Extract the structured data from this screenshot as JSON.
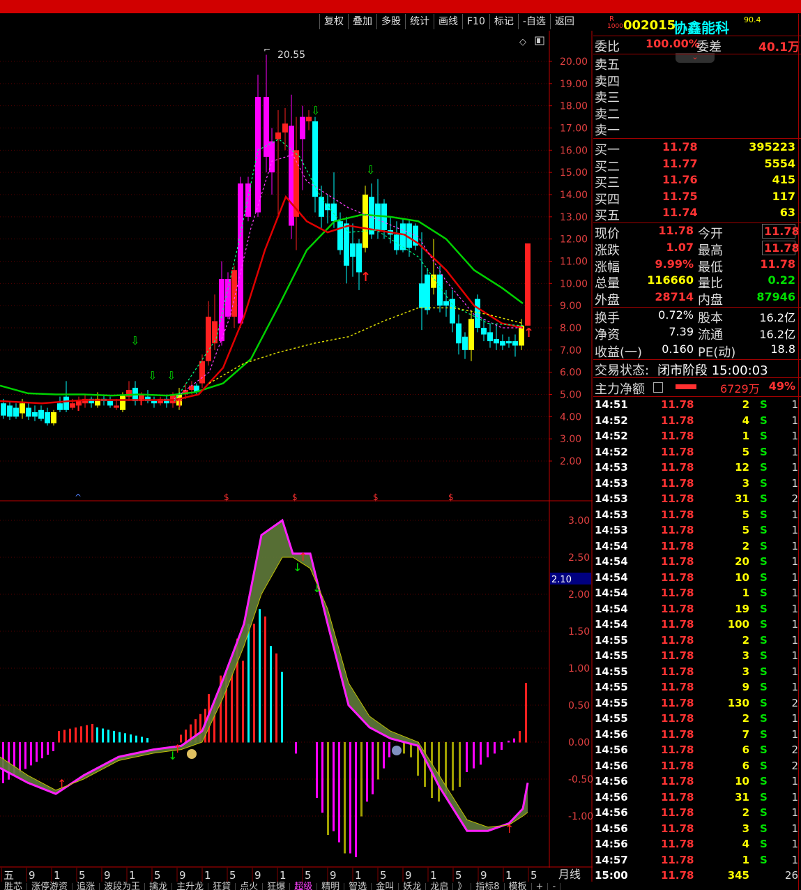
{
  "toolbar": [
    "复权",
    "叠加",
    "多股",
    "统计",
    "画线",
    "F10",
    "标记",
    "-自选",
    "返回"
  ],
  "stock": {
    "badge_top": "R",
    "badge_bottom": "1000",
    "code": "002015",
    "name": "协鑫能科",
    "score": "90.4"
  },
  "weibi": {
    "label": "委比",
    "value": "100.00%",
    "diff_label": "委差",
    "diff_value": "40.1万"
  },
  "sells": [
    {
      "label": "卖五"
    },
    {
      "label": "卖四"
    },
    {
      "label": "卖三"
    },
    {
      "label": "卖二"
    },
    {
      "label": "卖一"
    }
  ],
  "buys": [
    {
      "label": "买一",
      "price": "11.78",
      "vol": "395223"
    },
    {
      "label": "买二",
      "price": "11.77",
      "vol": "5554"
    },
    {
      "label": "买三",
      "price": "11.76",
      "vol": "415"
    },
    {
      "label": "买四",
      "price": "11.75",
      "vol": "117"
    },
    {
      "label": "买五",
      "price": "11.74",
      "vol": "63"
    }
  ],
  "quote": [
    {
      "l1": "现价",
      "v1": "11.78",
      "l2": "今开",
      "v2": "11.78",
      "c1": "red",
      "c2": "red",
      "box": true
    },
    {
      "l1": "涨跌",
      "v1": "1.07",
      "l2": "最高",
      "v2": "11.78",
      "c1": "red",
      "c2": "red",
      "box": true
    },
    {
      "l1": "涨幅",
      "v1": "9.99%",
      "l2": "最低",
      "v2": "11.78",
      "c1": "red",
      "c2": "red",
      "box": false
    },
    {
      "l1": "总量",
      "v1": "116660",
      "l2": "量比",
      "v2": "0.22",
      "c1": "yel",
      "c2": "grn",
      "box": false
    },
    {
      "l1": "外盘",
      "v1": "28714",
      "l2": "内盘",
      "v2": "87946",
      "c1": "red",
      "c2": "grn",
      "box": false
    }
  ],
  "fund": [
    {
      "l1": "换手",
      "v1": "0.72%",
      "l2": "股本",
      "v2": "16.2亿"
    },
    {
      "l1": "净资",
      "v1": "7.39",
      "l2": "流通",
      "v2": "16.2亿"
    },
    {
      "l1": "收益(一)",
      "v1": "0.160",
      "l2": "PE(动)",
      "v2": "18.8"
    }
  ],
  "status": {
    "label": "交易状态:",
    "value": "闭市阶段 15:00:03"
  },
  "main_flow": {
    "label": "主力净额",
    "value": "6729万",
    "pct": "49%"
  },
  "ticks": [
    [
      "14:51",
      "11.78",
      "2",
      "S",
      "1"
    ],
    [
      "14:52",
      "11.78",
      "4",
      "S",
      "1"
    ],
    [
      "14:52",
      "11.78",
      "1",
      "S",
      "1"
    ],
    [
      "14:52",
      "11.78",
      "5",
      "S",
      "1"
    ],
    [
      "14:53",
      "11.78",
      "12",
      "S",
      "1"
    ],
    [
      "14:53",
      "11.78",
      "3",
      "S",
      "1"
    ],
    [
      "14:53",
      "11.78",
      "31",
      "S",
      "2"
    ],
    [
      "14:53",
      "11.78",
      "5",
      "S",
      "1"
    ],
    [
      "14:53",
      "11.78",
      "5",
      "S",
      "1"
    ],
    [
      "14:54",
      "11.78",
      "2",
      "S",
      "1"
    ],
    [
      "14:54",
      "11.78",
      "20",
      "S",
      "1"
    ],
    [
      "14:54",
      "11.78",
      "10",
      "S",
      "1"
    ],
    [
      "14:54",
      "11.78",
      "1",
      "S",
      "1"
    ],
    [
      "14:54",
      "11.78",
      "19",
      "S",
      "1"
    ],
    [
      "14:54",
      "11.78",
      "100",
      "S",
      "1"
    ],
    [
      "14:55",
      "11.78",
      "2",
      "S",
      "1"
    ],
    [
      "14:55",
      "11.78",
      "3",
      "S",
      "1"
    ],
    [
      "14:55",
      "11.78",
      "3",
      "S",
      "1"
    ],
    [
      "14:55",
      "11.78",
      "9",
      "S",
      "1"
    ],
    [
      "14:55",
      "11.78",
      "130",
      "S",
      "2"
    ],
    [
      "14:55",
      "11.78",
      "2",
      "S",
      "1"
    ],
    [
      "14:56",
      "11.78",
      "7",
      "S",
      "1"
    ],
    [
      "14:56",
      "11.78",
      "6",
      "S",
      "2"
    ],
    [
      "14:56",
      "11.78",
      "6",
      "S",
      "2"
    ],
    [
      "14:56",
      "11.78",
      "10",
      "S",
      "1"
    ],
    [
      "14:56",
      "11.78",
      "31",
      "S",
      "1"
    ],
    [
      "14:56",
      "11.78",
      "2",
      "S",
      "1"
    ],
    [
      "14:56",
      "11.78",
      "3",
      "S",
      "1"
    ],
    [
      "14:56",
      "11.78",
      "4",
      "S",
      "1"
    ],
    [
      "14:57",
      "11.78",
      "1",
      "S",
      "1"
    ],
    [
      "15:00",
      "11.78",
      "345",
      "",
      "26"
    ]
  ],
  "main_axis": [
    "20.00",
    "19.00",
    "18.00",
    "17.00",
    "16.00",
    "15.00",
    "14.00",
    "13.00",
    "12.00",
    "11.00",
    "10.00",
    "9.00",
    "8.00",
    "7.00",
    "6.00",
    "5.00",
    "4.00",
    "3.00",
    "2.00"
  ],
  "sub_axis": [
    "3.00",
    "2.50",
    "2.00",
    "1.50",
    "1.00",
    "0.50",
    "0.00",
    "-0.50",
    "-1.00"
  ],
  "high_label": "20.55",
  "sub_current": "2.10",
  "period": "月线",
  "month_ticks": [
    "五",
    "9",
    "1",
    "5",
    "9",
    "1",
    "5",
    "9",
    "1",
    "5",
    "9",
    "1",
    "5",
    "9",
    "1",
    "5",
    "9",
    "1",
    "5",
    "9",
    "1",
    "5"
  ],
  "bottom_tabs": [
    "胜芯",
    "涨停游资",
    "追涨",
    "波段为王",
    "擒龙",
    "主升龙",
    "狂貸",
    "点火",
    "狂爆",
    "超级",
    "精明",
    "智选",
    "金叫",
    "妖龙",
    "龙启",
    "》",
    "指标8",
    "模板",
    "+",
    "-"
  ]
}
